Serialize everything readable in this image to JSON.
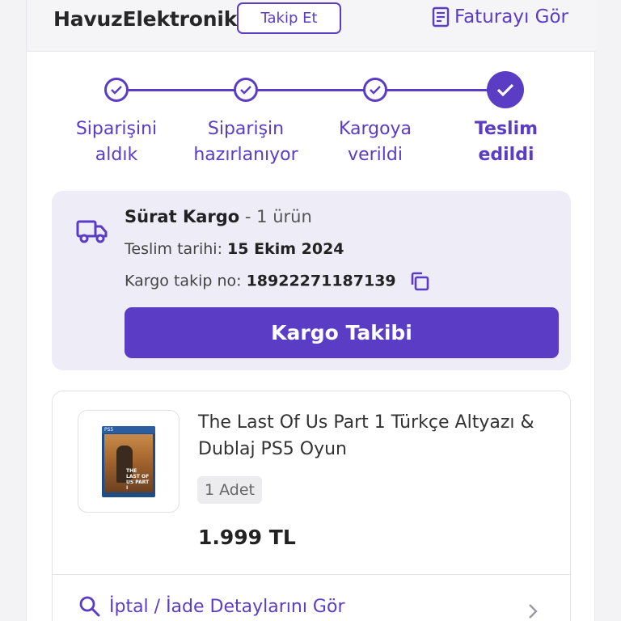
{
  "header": {
    "seller_name": "HavuzElektronik",
    "follow_label": "Takip Et",
    "invoice_label": "Faturayı Gör"
  },
  "steps": [
    {
      "line1": "Siparişini",
      "line2": "aldık",
      "state": "done"
    },
    {
      "line1": "Siparişin",
      "line2": "hazırlanıyor",
      "state": "done"
    },
    {
      "line1": "Kargoya",
      "line2": "verildi",
      "state": "done"
    },
    {
      "line1": "Teslim",
      "line2": "edildi",
      "state": "current"
    }
  ],
  "shipment": {
    "carrier": "Sürat Kargo",
    "item_count": "- 1 ürün",
    "delivery_label": "Teslim tarihi:",
    "delivery_date": "15 Ekim 2024",
    "tracking_label": "Kargo takip no:",
    "tracking_no": "18922271187139",
    "track_button": "Kargo Takibi"
  },
  "product": {
    "name": "The Last Of Us Part 1 Türkçe Altyazı & Dublaj PS5 Oyun",
    "quantity": "1 Adet",
    "price": "1.999 TL",
    "cover_brand": "PS5",
    "cover_title": "THE LAST OF US PART I",
    "refund_label": "İptal / İade Detaylarını Gör"
  },
  "colors": {
    "accent": "#5b3cc4",
    "ship_bg": "#eeecf7"
  },
  "icons": {
    "invoice": "document-icon",
    "truck": "truck-icon",
    "copy": "copy-icon",
    "search": "search-icon",
    "chevron": "chevron-right-icon",
    "check": "check-icon"
  }
}
